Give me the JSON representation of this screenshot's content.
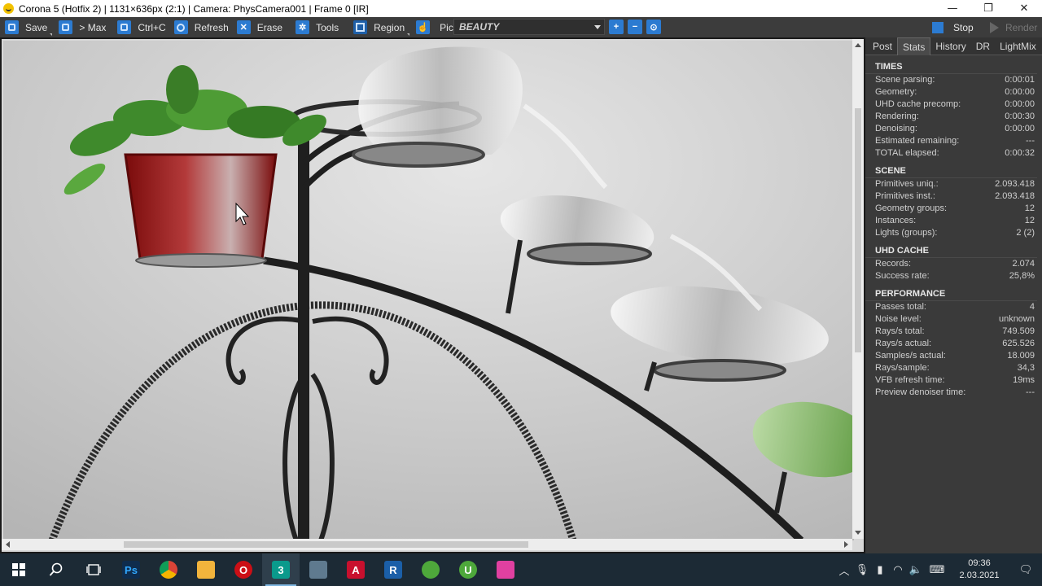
{
  "window": {
    "title": "Corona 5 (Hotfix 2) | 1131×636px (2:1) | Camera: PhysCamera001 | Frame 0 [IR]",
    "minimize_glyph": "—",
    "restore_glyph": "❐",
    "close_glyph": "✕"
  },
  "toolbar": {
    "save": "Save",
    "max": "> Max",
    "copy": "Ctrl+C",
    "refresh": "Refresh",
    "erase": "Erase",
    "tools": "Tools",
    "region": "Region",
    "pick": "Pick",
    "render_element": "BEAUTY",
    "stop": "Stop",
    "render": "Render"
  },
  "tabs": [
    "Post",
    "Stats",
    "History",
    "DR",
    "LightMix"
  ],
  "active_tab": "Stats",
  "stats": {
    "times": {
      "title": "TIMES",
      "rows": [
        {
          "label": "Scene parsing:",
          "value": "0:00:01"
        },
        {
          "label": "Geometry:",
          "value": "0:00:00"
        },
        {
          "label": "UHD cache precomp:",
          "value": "0:00:00"
        },
        {
          "label": "Rendering:",
          "value": "0:00:30"
        },
        {
          "label": "Denoising:",
          "value": "0:00:00"
        },
        {
          "label": "Estimated remaining:",
          "value": "---"
        },
        {
          "label": "TOTAL elapsed:",
          "value": "0:00:32"
        }
      ]
    },
    "scene": {
      "title": "SCENE",
      "rows": [
        {
          "label": "Primitives uniq.:",
          "value": "2.093.418"
        },
        {
          "label": "Primitives inst.:",
          "value": "2.093.418"
        },
        {
          "label": "Geometry groups:",
          "value": "12"
        },
        {
          "label": "Instances:",
          "value": "12"
        },
        {
          "label": "Lights (groups):",
          "value": "2 (2)"
        }
      ]
    },
    "uhd_cache": {
      "title": "UHD CACHE",
      "rows": [
        {
          "label": "Records:",
          "value": "2.074"
        },
        {
          "label": "Success rate:",
          "value": "25,8%"
        }
      ]
    },
    "performance": {
      "title": "PERFORMANCE",
      "rows": [
        {
          "label": "Passes total:",
          "value": "4"
        },
        {
          "label": "Noise level:",
          "value": "unknown"
        },
        {
          "label": "Rays/s total:",
          "value": "749.509"
        },
        {
          "label": "Rays/s actual:",
          "value": "625.526"
        },
        {
          "label": "Samples/s actual:",
          "value": "18.009"
        },
        {
          "label": "Rays/sample:",
          "value": "34,3"
        },
        {
          "label": "VFB refresh time:",
          "value": "19ms"
        },
        {
          "label": "Preview denoiser time:",
          "value": "---"
        }
      ]
    }
  },
  "taskbar": {
    "apps": [
      {
        "name": "photoshop",
        "glyph": "Ps",
        "color": "#0f2c4d",
        "fg": "#31a8ff"
      },
      {
        "name": "chrome",
        "glyph": "",
        "color": "#e8e8e8",
        "fg": "#db4437"
      },
      {
        "name": "file-explorer",
        "glyph": "",
        "color": "#f2b43c",
        "fg": "#f2b43c"
      },
      {
        "name": "opera",
        "glyph": "O",
        "color": "#cc0f16",
        "fg": "#ffffff"
      },
      {
        "name": "3ds-max",
        "glyph": "3",
        "color": "#0a9a8c",
        "fg": "#ffffff"
      },
      {
        "name": "image-viewer",
        "glyph": "",
        "color": "#5f7a8f",
        "fg": "#ffffff"
      },
      {
        "name": "autocad",
        "glyph": "A",
        "color": "#c8102e",
        "fg": "#ffffff"
      },
      {
        "name": "revit",
        "glyph": "R",
        "color": "#1b5fa8",
        "fg": "#ffffff"
      },
      {
        "name": "utorrent",
        "glyph": "",
        "color": "#4ea83b",
        "fg": "#ffffff"
      },
      {
        "name": "utorrent-web",
        "glyph": "U",
        "color": "#4ea83b",
        "fg": "#ffffff"
      },
      {
        "name": "color-picker",
        "glyph": "",
        "color": "#e040a0",
        "fg": "#ffffff"
      }
    ],
    "time": "09:36",
    "date": "2.03.2021"
  }
}
